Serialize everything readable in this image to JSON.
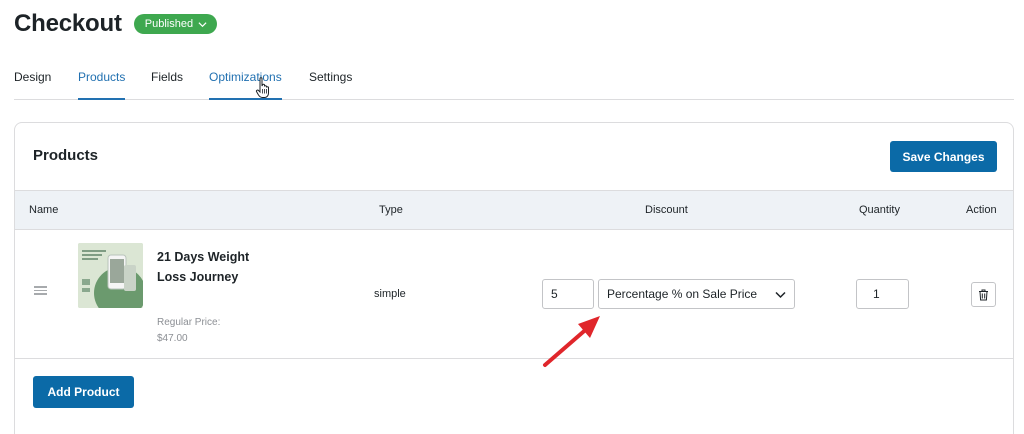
{
  "page": {
    "title": "Checkout",
    "status_label": "Published"
  },
  "tabs": [
    {
      "label": "Design"
    },
    {
      "label": "Products"
    },
    {
      "label": "Fields"
    },
    {
      "label": "Optimizations"
    },
    {
      "label": "Settings"
    }
  ],
  "products_card": {
    "title": "Products",
    "save_label": "Save Changes",
    "add_label": "Add Product",
    "columns": [
      "Name",
      "Type",
      "Discount",
      "Quantity",
      "Action"
    ],
    "rows": [
      {
        "name": "21 Days Weight Loss Journey",
        "price_label": "Regular Price:",
        "price": "$47.00",
        "type": "simple",
        "discount_value": "5",
        "discount_type": "Percentage % on Sale Price",
        "quantity": "1"
      }
    ]
  },
  "colors": {
    "accent": "#2271b1",
    "primary_button": "#0b6aa7",
    "published": "#3ea84f",
    "annotation_arrow": "#e0262b"
  },
  "icons": [
    "chevron-down-icon",
    "pointer-hand-icon",
    "drag-handle-icon",
    "trash-icon",
    "annotation-arrow"
  ]
}
